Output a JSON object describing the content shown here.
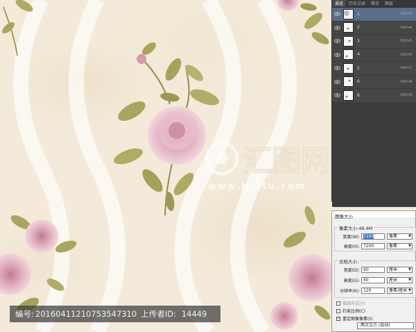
{
  "watermark": {
    "id_label": "编号:",
    "id_value": "20160411210753547310",
    "uploader_label": "上传者ID:",
    "uploader_value": "14449"
  },
  "logo_text": "汇图网",
  "logo_url_text": "www.Huitu.com",
  "layers_panel": {
    "tabs": [
      "通道",
      "历史记录",
      "路径",
      "图层"
    ],
    "active_tab": 0,
    "rows": [
      {
        "name": "1",
        "shortcut": "Ctrl+3",
        "selected": true
      },
      {
        "name": "2",
        "shortcut": "Ctrl+4",
        "selected": false
      },
      {
        "name": "3",
        "shortcut": "Ctrl+5",
        "selected": false
      },
      {
        "name": "4",
        "shortcut": "Ctrl+6",
        "selected": false
      },
      {
        "name": "5",
        "shortcut": "Ctrl+7",
        "selected": false
      },
      {
        "name": "6",
        "shortcut": "Ctrl+8",
        "selected": false
      },
      {
        "name": "6",
        "shortcut": "Ctrl+9",
        "selected": false
      }
    ]
  },
  "image_size_dialog": {
    "title": "图像大小",
    "pixel_dimensions_label": "像素大小:49.4M",
    "width_label": "宽度(W):",
    "width_value": "7200",
    "height_label": "高度(H):",
    "height_value": "7200",
    "pixel_unit": "像素",
    "document_size_label": "文档大小:",
    "doc_width_label": "宽度(D):",
    "doc_width_value": "60",
    "doc_height_label": "高度(G):",
    "doc_height_value": "60",
    "doc_unit": "厘米",
    "resolution_label": "分辨率(R):",
    "resolution_value": "120",
    "resolution_unit": "像素/厘米",
    "scale_styles_label": "缩放样式(Y)",
    "scale_styles_checked": false,
    "constrain_label": "约束比例(C)",
    "constrain_checked": false,
    "resample_label": "重定图像像素(I):",
    "resample_checked": true,
    "resample_value": "两次立方 (自动)"
  },
  "colors": {
    "panel_bg": "#464646",
    "selected_row": "#5a6e8c",
    "rose": "#d9a7b4",
    "leaf": "#a8a35a"
  }
}
